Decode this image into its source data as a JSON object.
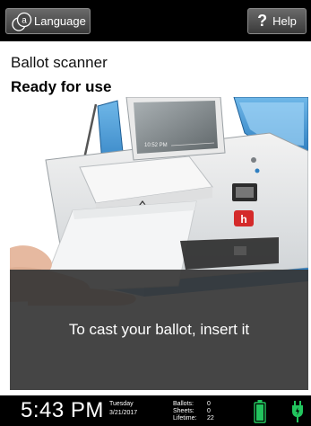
{
  "header": {
    "language_label": "Language",
    "help_label": "Help",
    "help_glyph": "?",
    "language_icon": "language-icon"
  },
  "scanner": {
    "title": "Ballot scanner",
    "status": "Ready for use"
  },
  "illustration": {
    "screen_time": "10:52 PM"
  },
  "instruction": {
    "text": "To cast your ballot, insert it"
  },
  "status_bar": {
    "time": "5:43 PM",
    "day": "Tuesday",
    "date": "3/21/2017",
    "ballots_label": "Ballots:",
    "ballots_value": "0",
    "sheets_label": "Sheets:",
    "sheets_value": "0",
    "lifetime_label": "Lifetime:",
    "lifetime_value": "22",
    "battery_color": "#22c55e",
    "power_icon": "plug-icon"
  }
}
